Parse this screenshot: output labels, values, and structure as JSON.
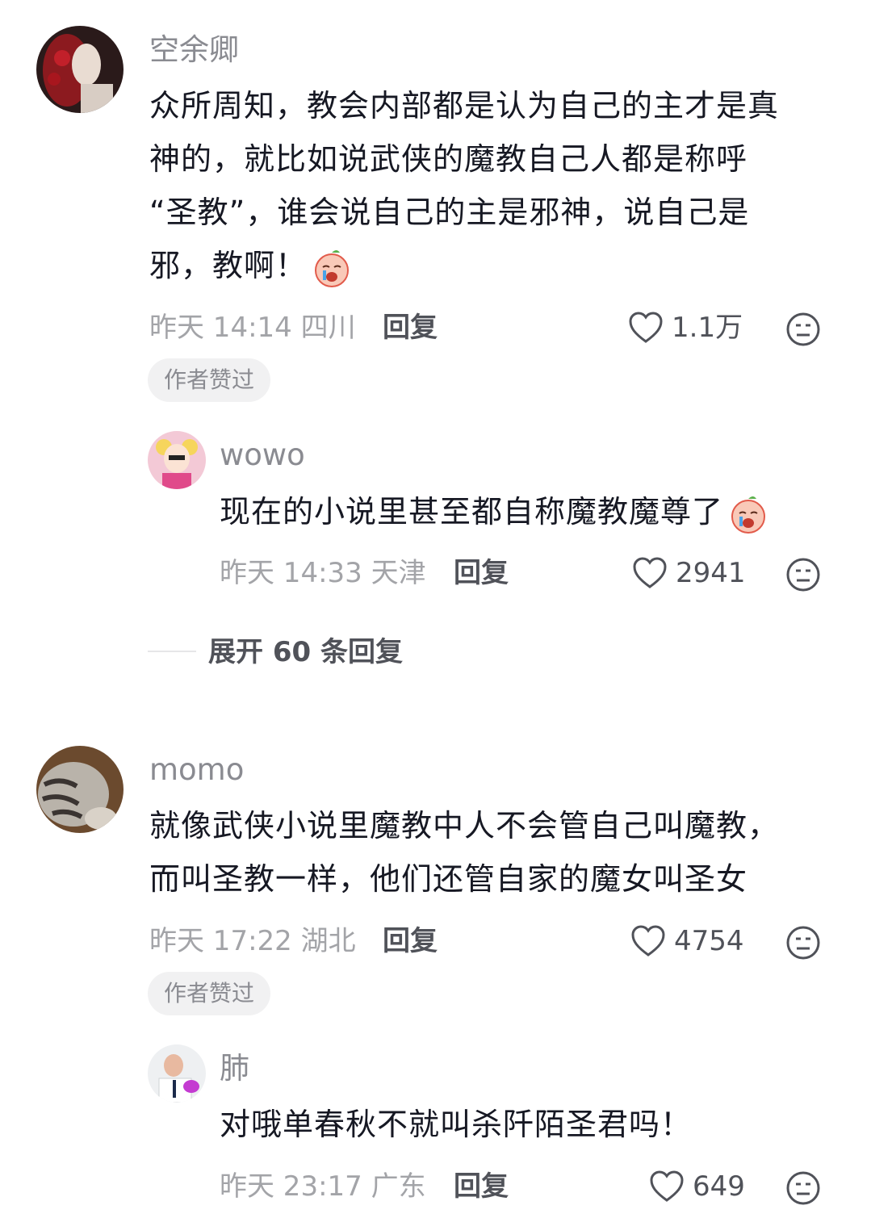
{
  "comments": [
    {
      "username": "空余卿",
      "lines": [
        "众所周知，教会内部都是认为自己的主才是真",
        "神的，就比如说武侠的魔教自己人都是称呼",
        "“圣教”，谁会说自己的主是邪神，说自己是",
        "邪，教啊！"
      ],
      "time": "昨天 14:14",
      "location": "四川",
      "reply_label": "回复",
      "likes": "1.1万",
      "badge": "作者赞过",
      "emoji": "crying-face"
    },
    {
      "username": "wowo",
      "lines": [
        "现在的小说里甚至都自称魔教魔尊了"
      ],
      "time": "昨天 14:33",
      "location": "天津",
      "reply_label": "回复",
      "likes": "2941",
      "emoji": "crying-face"
    },
    {
      "username": "momo",
      "lines": [
        "就像武侠小说里魔教中人不会管自己叫魔教，",
        "而叫圣教一样，他们还管自家的魔女叫圣女"
      ],
      "time": "昨天 17:22",
      "location": "湖北",
      "reply_label": "回复",
      "likes": "4754",
      "badge": "作者赞过"
    },
    {
      "username": "肺",
      "lines": [
        "对哦单春秋不就叫杀阡陌圣君吗！"
      ],
      "time": "昨天 23:17",
      "location": "广东",
      "reply_label": "回复",
      "likes": "649"
    }
  ],
  "expand_replies": "展开 60 条回复",
  "icons": {
    "like": "heart-outline-icon",
    "dislike": "meh-face-icon"
  },
  "colors": {
    "text": "#161823",
    "meta": "#a3a4a8",
    "username": "#8a8b91"
  }
}
